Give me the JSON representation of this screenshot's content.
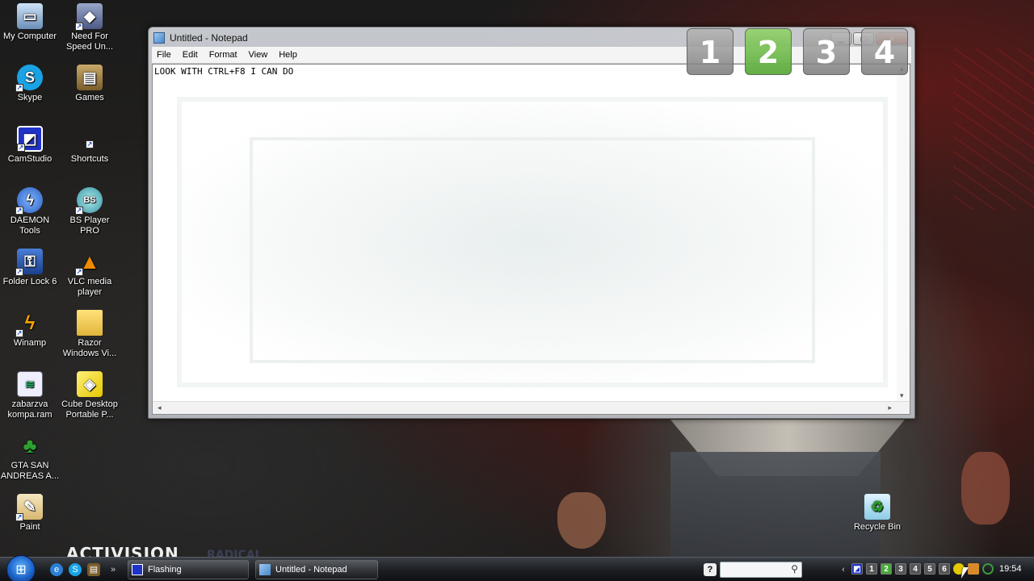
{
  "desktop_icons": [
    {
      "label": "My Computer"
    },
    {
      "label": "Need For Speed Un..."
    },
    {
      "label": "Skype"
    },
    {
      "label": "Games"
    },
    {
      "label": "CamStudio"
    },
    {
      "label": "Shortcuts"
    },
    {
      "label": "DAEMON Tools"
    },
    {
      "label": "BS Player PRO"
    },
    {
      "label": "Folder Lock 6"
    },
    {
      "label": "VLC media player"
    },
    {
      "label": "Winamp"
    },
    {
      "label": "Razor Windows Vi..."
    },
    {
      "label": "zabarzva kompa.ram"
    },
    {
      "label": "Cube Desktop Portable P..."
    },
    {
      "label": "GTA SAN ANDREAS A..."
    },
    {
      "label": "Paint"
    },
    {
      "label": "Recycle Bin"
    }
  ],
  "notepad": {
    "title": "Untitled - Notepad",
    "menus": [
      "File",
      "Edit",
      "Format",
      "View",
      "Help"
    ],
    "content": "LOOK WITH CTRL+F8 I CAN DO"
  },
  "virtual_desktops": {
    "tiles": [
      "1",
      "2",
      "3",
      "4"
    ],
    "active_index": 1
  },
  "wallpaper": {
    "logo_text": "ACTIVISION",
    "radical_text": "RADICAL"
  },
  "taskbar": {
    "tasks": [
      {
        "label": "Flashing"
      },
      {
        "label": "Untitled - Notepad"
      }
    ],
    "search_placeholder": "",
    "desktop_switcher": [
      "1",
      "2",
      "3",
      "4",
      "5",
      "6"
    ],
    "active_desktop": "2",
    "clock": "19:54"
  },
  "colors": {
    "active_desktop": "#4aa83a",
    "close_button": "#c8452b"
  }
}
